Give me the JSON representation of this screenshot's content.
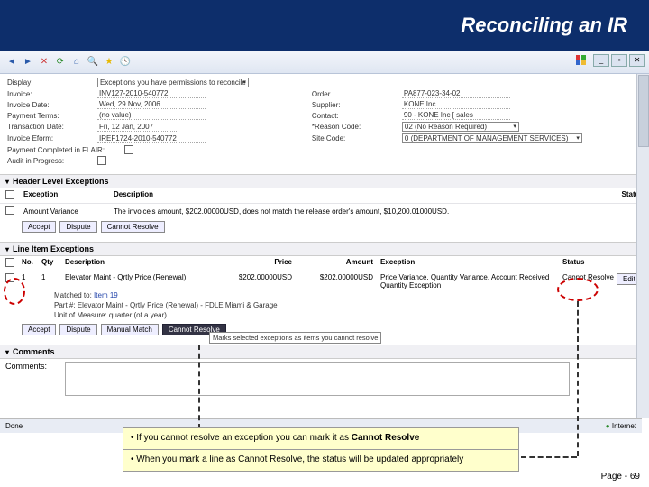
{
  "slide": {
    "title": "Reconciling an IR",
    "page_label": "Page - 69"
  },
  "browser": {
    "done_label": "Done",
    "zone_label": "Internet"
  },
  "form": {
    "display_label": "Display:",
    "display_value": "Exceptions you have permissions to reconcile",
    "invoice_label": "Invoice:",
    "invoice_value": "INV127-2010-540772",
    "invdate_label": "Invoice Date:",
    "invdate_value": "Wed, 29 Nov, 2006",
    "payterms_label": "Payment Terms:",
    "payterms_value": "(no value)",
    "txndate_label": "Transaction Date:",
    "txndate_value": "Fri, 12 Jan, 2007",
    "eform_label": "Invoice Eform:",
    "eform_value": "IREF1724-2010-540772",
    "completed_label": "Payment Completed in FLAIR:",
    "audit_label": "Audit in Progress:",
    "order_label": "Order",
    "order_value": "PA877-023-34-02",
    "supplier_label": "Supplier:",
    "supplier_value": "KONE Inc.",
    "contact_label": "Contact:",
    "contact_value": "90 - KONE Inc [ sales",
    "reason_label": "*Reason Code:",
    "reason_value": "02 (No Reason Required)",
    "site_label": "Site Code:",
    "site_value": "0 (DEPARTMENT OF MANAGEMENT SERVICES)"
  },
  "header_exc": {
    "section": "Header Level Exceptions",
    "cols": {
      "exception": "Exception",
      "description": "Description",
      "status": "Status"
    },
    "row": {
      "name": "Amount Variance",
      "desc": "The invoice's amount, $202.00000USD, does not match the release order's amount, $10,200.01000USD."
    }
  },
  "line_exc": {
    "section": "Line Item Exceptions",
    "cols": {
      "no": "No.",
      "qty": "Qty",
      "desc": "Description",
      "price": "Price",
      "amount": "Amount",
      "exception": "Exception",
      "status": "Status"
    },
    "row": {
      "no": "1",
      "qty": "1",
      "desc": "Elevator Maint - Qrtly Price (Renewal)",
      "price": "$202.00000USD",
      "amount": "$202.00000USD",
      "exception": "Price Variance, Quantity Variance, Account Received Quantity Exception",
      "status": "Cannot Resolve",
      "edit_btn": "Edit"
    },
    "matched": {
      "label": "Matched to:",
      "item": "Item 19",
      "part": "Part #: Elevator Maint - Qrtly Price (Renewal) - FDLE Miami & Garage",
      "uom": "Unit of Measure: quarter (of a year)"
    }
  },
  "buttons": {
    "accept": "Accept",
    "dispute": "Dispute",
    "cannot_resolve": "Cannot Resolve",
    "manual_match": "Manual Match"
  },
  "comments": {
    "section": "Comments",
    "label": "Comments:"
  },
  "tooltip": "Marks selected exceptions as items you cannot resolve",
  "callouts": {
    "a": "• If you cannot resolve an exception you can mark it as ",
    "a_bold": "Cannot Resolve",
    "b": "• When you mark a line as Cannot Resolve, the status will be updated appropriately"
  }
}
